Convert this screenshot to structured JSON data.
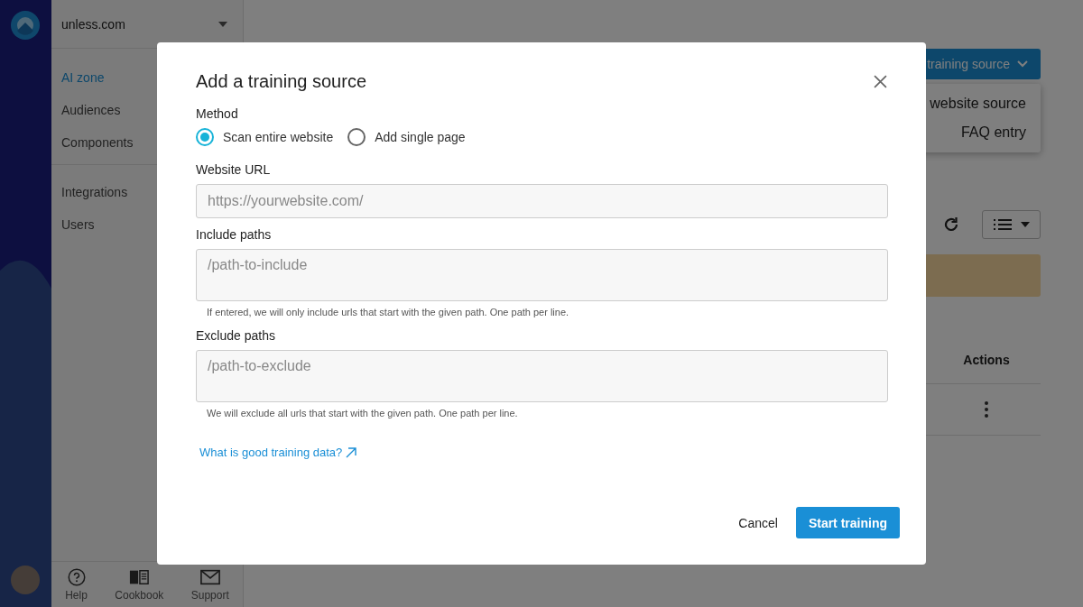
{
  "sidebar": {
    "workspace": "unless.com",
    "nav_groups": [
      [
        {
          "label": "AI zone",
          "selected": true
        },
        {
          "label": "Audiences",
          "selected": false
        },
        {
          "label": "Components",
          "selected": false
        }
      ],
      [
        {
          "label": "Integrations",
          "selected": false
        },
        {
          "label": "Users",
          "selected": false
        }
      ]
    ],
    "footer_links": [
      {
        "label": "Help",
        "kind": "help"
      },
      {
        "label": "Cookbook",
        "kind": "cookbook"
      },
      {
        "label": "Support",
        "kind": "support"
      }
    ]
  },
  "main": {
    "add_button": "training source",
    "add_menu": [
      "website source",
      "FAQ entry"
    ],
    "table": {
      "columns": [
        "Actions"
      ]
    }
  },
  "dialog": {
    "title": "Add a training source",
    "method": {
      "label": "Method",
      "options": [
        {
          "label": "Scan entire website",
          "selected": true
        },
        {
          "label": "Add single page",
          "selected": false
        }
      ]
    },
    "fields": [
      {
        "label": "Website URL",
        "kind": "input",
        "placeholder": "https://yourwebsite.com/"
      },
      {
        "label": "Include paths",
        "kind": "textarea",
        "placeholder": "/path-to-include",
        "hint": "If entered, we will only include urls that start with the given path. One path per line."
      },
      {
        "label": "Exclude paths",
        "kind": "textarea",
        "placeholder": "/path-to-exclude",
        "hint": "We will exclude all urls that start with the given path. One path per line."
      }
    ],
    "help_link": "What is good training data?",
    "cancel": "Cancel",
    "submit": "Start training"
  }
}
